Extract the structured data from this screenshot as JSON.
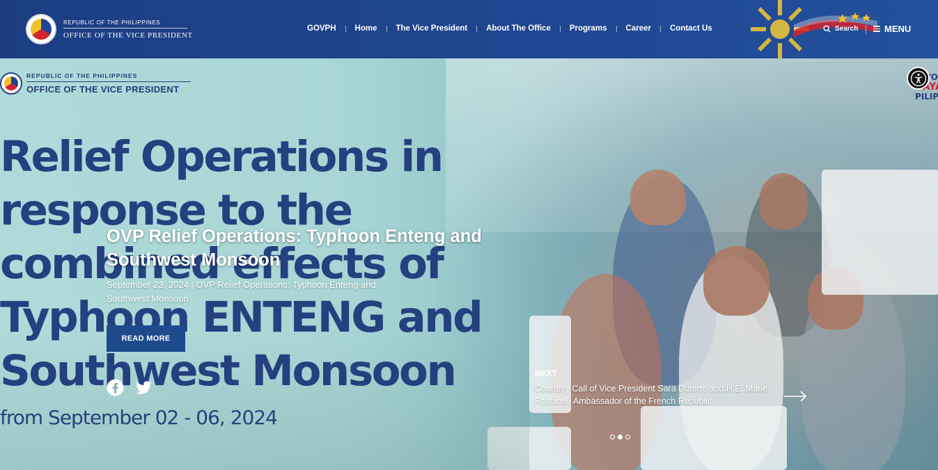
{
  "header": {
    "brand_small": "REPUBLIC OF THE PHILIPPINES",
    "brand_big": "OFFICE OF THE VICE PRESIDENT",
    "nav": [
      "GOVPH",
      "Home",
      "The Vice President",
      "About The Office",
      "Programs",
      "Career",
      "Contact Us"
    ],
    "search_label": "Search",
    "menu_label": "MENU"
  },
  "poster": {
    "logo_small": "REPUBLIC OF THE PHILIPPINES",
    "logo_big": "OFFICE OF THE VICE PRESIDENT",
    "title_lines": [
      "Relief Operations in",
      "response to the",
      "combined effects of",
      "Typhoon ENTENG and",
      "Southwest Monsoon"
    ],
    "date_line": "from September 02 - 06, 2024",
    "side_text_a": "DIYOS",
    "side_text_b": "BAYAN",
    "side_text_c": "PILIP"
  },
  "slide": {
    "title": "OVP Relief Operations: Typhoon Enteng and Southwest Monsoon",
    "meta": "September 23, 2024 | OVP Relief Operations: Typhoon Enteng and Southwest Monsoon",
    "read_more": "READ MORE",
    "next_label": "NEXT",
    "next_title": "Courtesy Call of Vice President Sara Duterte and H.E. Marie Fontanel, Ambassador of the French Republic",
    "dots_total": 3,
    "dots_active_index": 1
  },
  "colors": {
    "header_bg": "#1f4690",
    "accent_blue": "#1e4a8e",
    "poster_text": "#24407f",
    "hero_bg": "#a6d3d3"
  },
  "icons": [
    "seal-icon",
    "sun-icon",
    "search-icon",
    "menu-icon",
    "facebook-icon",
    "twitter-icon",
    "arrow-right-icon",
    "accessibility-icon"
  ]
}
